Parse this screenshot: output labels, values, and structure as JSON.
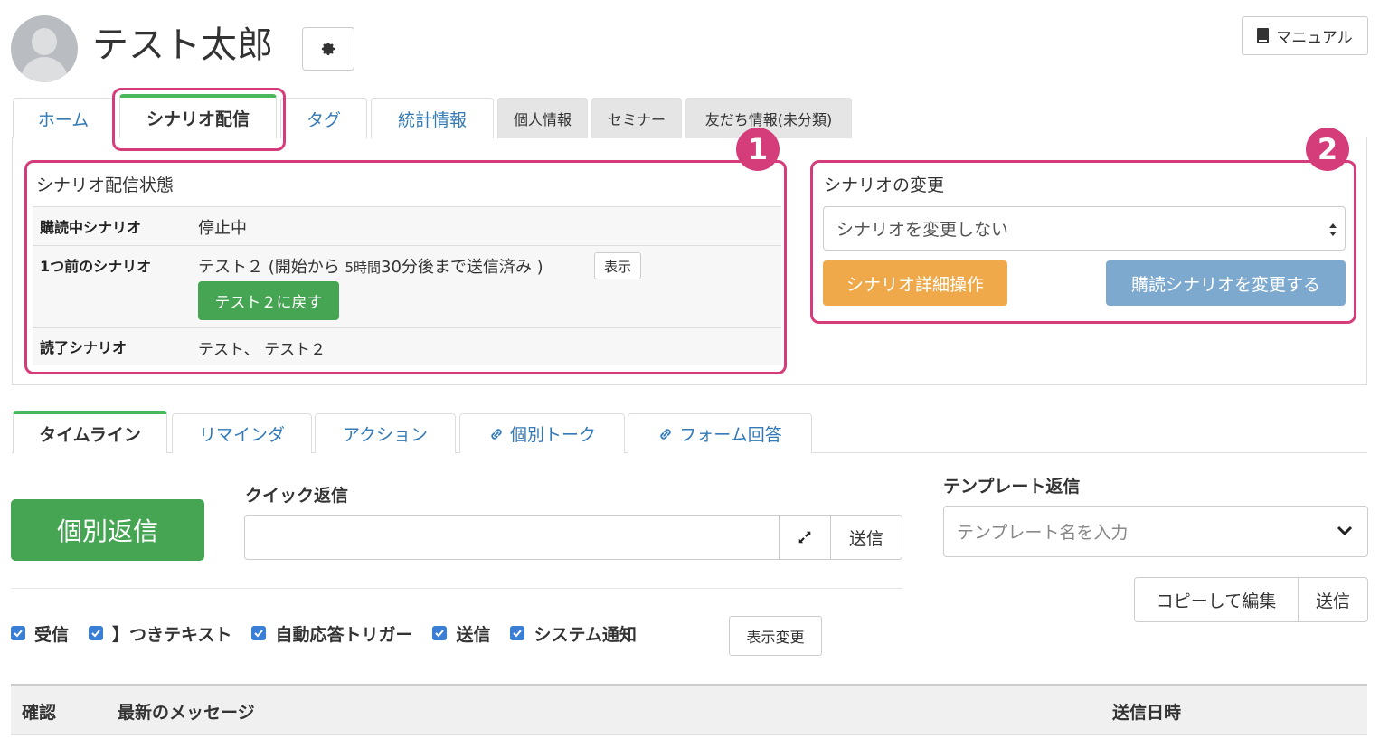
{
  "header": {
    "user_name": "テスト太郎",
    "manual_label": "マニュアル"
  },
  "top_tabs": {
    "home": "ホーム",
    "scenario": "シナリオ配信",
    "tag": "タグ",
    "stats": "統計情報",
    "personal": "個人情報",
    "seminar": "セミナー",
    "friend_info": "友だち情報(未分類)"
  },
  "badges": {
    "one": "1",
    "two": "2"
  },
  "scenario_status": {
    "title": "シナリオ配信状態",
    "rows": [
      {
        "label": "購読中シナリオ",
        "value": "停止中"
      },
      {
        "label": "1つ前のシナリオ",
        "value_main": "テスト２ (開始から ",
        "value_small": "5時間",
        "value_num": "30分後まで送信済み )",
        "show_btn": "表示",
        "return_btn": "テスト２に戻す"
      },
      {
        "label": "読了シナリオ",
        "value": "テスト、 テスト２"
      }
    ]
  },
  "scenario_change": {
    "title": "シナリオの変更",
    "select_value": "シナリオを変更しない",
    "detail_btn": "シナリオ詳細操作",
    "change_btn": "購読シナリオを変更する"
  },
  "bottom_tabs": {
    "timeline": "タイムライン",
    "reminder": "リマインダ",
    "action": "アクション",
    "individual_talk": "個別トーク",
    "form_answers": "フォーム回答"
  },
  "reply": {
    "individual_btn": "個別返信",
    "quick_label": "クイック返信",
    "quick_send": "送信",
    "template_label": "テンプレート返信",
    "template_placeholder": "テンプレート名を入力",
    "copy_edit": "コピーして編集",
    "template_send": "送信"
  },
  "filters": {
    "items": [
      "受信",
      "】つきテキスト",
      "自動応答トリガー",
      "送信",
      "システム通知"
    ],
    "change_btn": "表示変更"
  },
  "table": {
    "col_confirm": "確認",
    "col_latest": "最新のメッセージ",
    "col_date": "送信日時"
  },
  "colors": {
    "accent_pink": "#d43d7a",
    "green": "#45a552",
    "orange": "#efa94a",
    "blue": "#7ea9cf",
    "link": "#337ab7"
  }
}
